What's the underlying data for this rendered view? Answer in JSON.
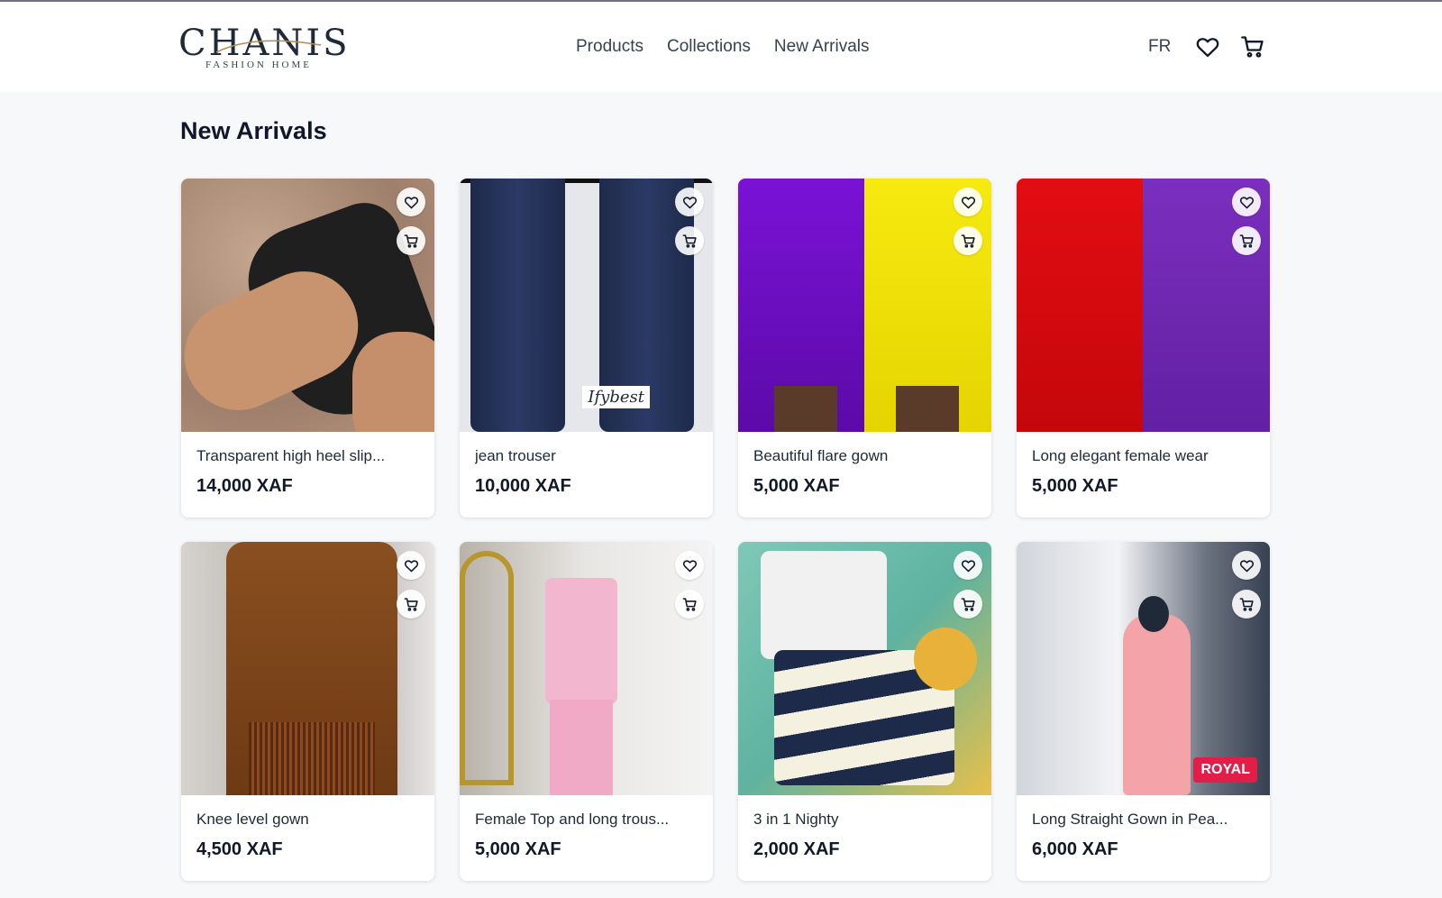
{
  "brand": {
    "name": "CHANIS",
    "tagline": "FASHION HOME"
  },
  "nav": {
    "items": [
      "Products",
      "Collections",
      "New Arrivals"
    ]
  },
  "header": {
    "language": "FR"
  },
  "section": {
    "title": "New Arrivals"
  },
  "products": [
    {
      "name": "Transparent high heel slip...",
      "price": "14,000 XAF"
    },
    {
      "name": "jean trouser",
      "price": "10,000 XAF",
      "watermark": "Ifybest"
    },
    {
      "name": "Beautiful flare gown",
      "price": "5,000 XAF"
    },
    {
      "name": "Long elegant female wear",
      "price": "5,000 XAF"
    },
    {
      "name": "Knee level gown",
      "price": "4,500 XAF"
    },
    {
      "name": "Female Top and long trous...",
      "price": "5,000 XAF"
    },
    {
      "name": "3 in 1 Nighty",
      "price": "2,000 XAF"
    },
    {
      "name": "Long Straight Gown in Pea...",
      "price": "6,000 XAF",
      "badge": "ROYAL"
    }
  ],
  "icons": {
    "wishlist": "heart-icon",
    "cart": "cart-icon"
  },
  "colors": {
    "background": "#f7f8fa",
    "text": "#111827",
    "badge": "#e11d48"
  }
}
